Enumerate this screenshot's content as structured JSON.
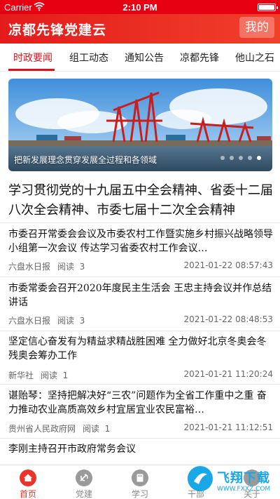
{
  "status": {
    "carrier": "Carrier",
    "time": "2:10 PM"
  },
  "header": {
    "title": "凉都先锋党建云",
    "mine_label": "我的"
  },
  "tabs": [
    {
      "label": "时政要闻",
      "active": true
    },
    {
      "label": "组工动态"
    },
    {
      "label": "通知公告"
    },
    {
      "label": "凉都先锋"
    },
    {
      "label": "他山之石"
    }
  ],
  "banner": {
    "caption": "把新发展理念贯穿发展全过程和各领域",
    "page_count": 5,
    "active_page": 5
  },
  "headline": "学习贯彻党的十九届五中全会精神、省委十二届八次全会精神、市委七届十二次全会精神",
  "news": [
    {
      "title": "市委召开常委会会议及市委农村工作暨实施乡村振兴战略领导小组第一次会议 传达学习省委农村工作会议…",
      "source": "六盘水日报",
      "read_label": "阅读",
      "reads": "3",
      "date": "2021-01-22 08:57:43"
    },
    {
      "title": "市委常委会召开2020年度民主生活会 王忠主持会议并作总结讲话",
      "source": "六盘水日报",
      "read_label": "阅读",
      "reads": "3",
      "date": "2021-01-22 08:48:53"
    },
    {
      "title": "坚定信心奋发有为精益求精战胜困难 全力做好北京冬奥会冬残奥会筹办工作",
      "source": "新华社",
      "read_label": "阅读",
      "reads": "1",
      "date": "2021-01-21 11:20:24"
    },
    {
      "title": "谌贻琴：坚持把解决好“三农”问题作为全省工作重中之重 奋力推动农业高质高效乡村宜居宜业农民富裕…",
      "source": "贵州省人民政府网",
      "read_label": "阅读",
      "reads": "1",
      "date": "2021-01-21 11:12:51"
    },
    {
      "title": "李刚主持召开市政府常务会议"
    }
  ],
  "tabbar": [
    {
      "label": "首页",
      "icon": "home-icon",
      "active": true
    },
    {
      "label": "党建",
      "icon": "party-emblem-icon"
    },
    {
      "label": "学习",
      "icon": "book-icon"
    },
    {
      "label": "干部",
      "icon": "person-icon"
    },
    {
      "label": "关于",
      "icon": "info-icon"
    }
  ],
  "watermark": {
    "text": "飞翔下载",
    "url": "WWW.FXXZ.COM"
  },
  "colors": {
    "primary_red": "#e60012",
    "tab_active": "#d8141e",
    "watermark_blue": "#1aa7e6"
  }
}
